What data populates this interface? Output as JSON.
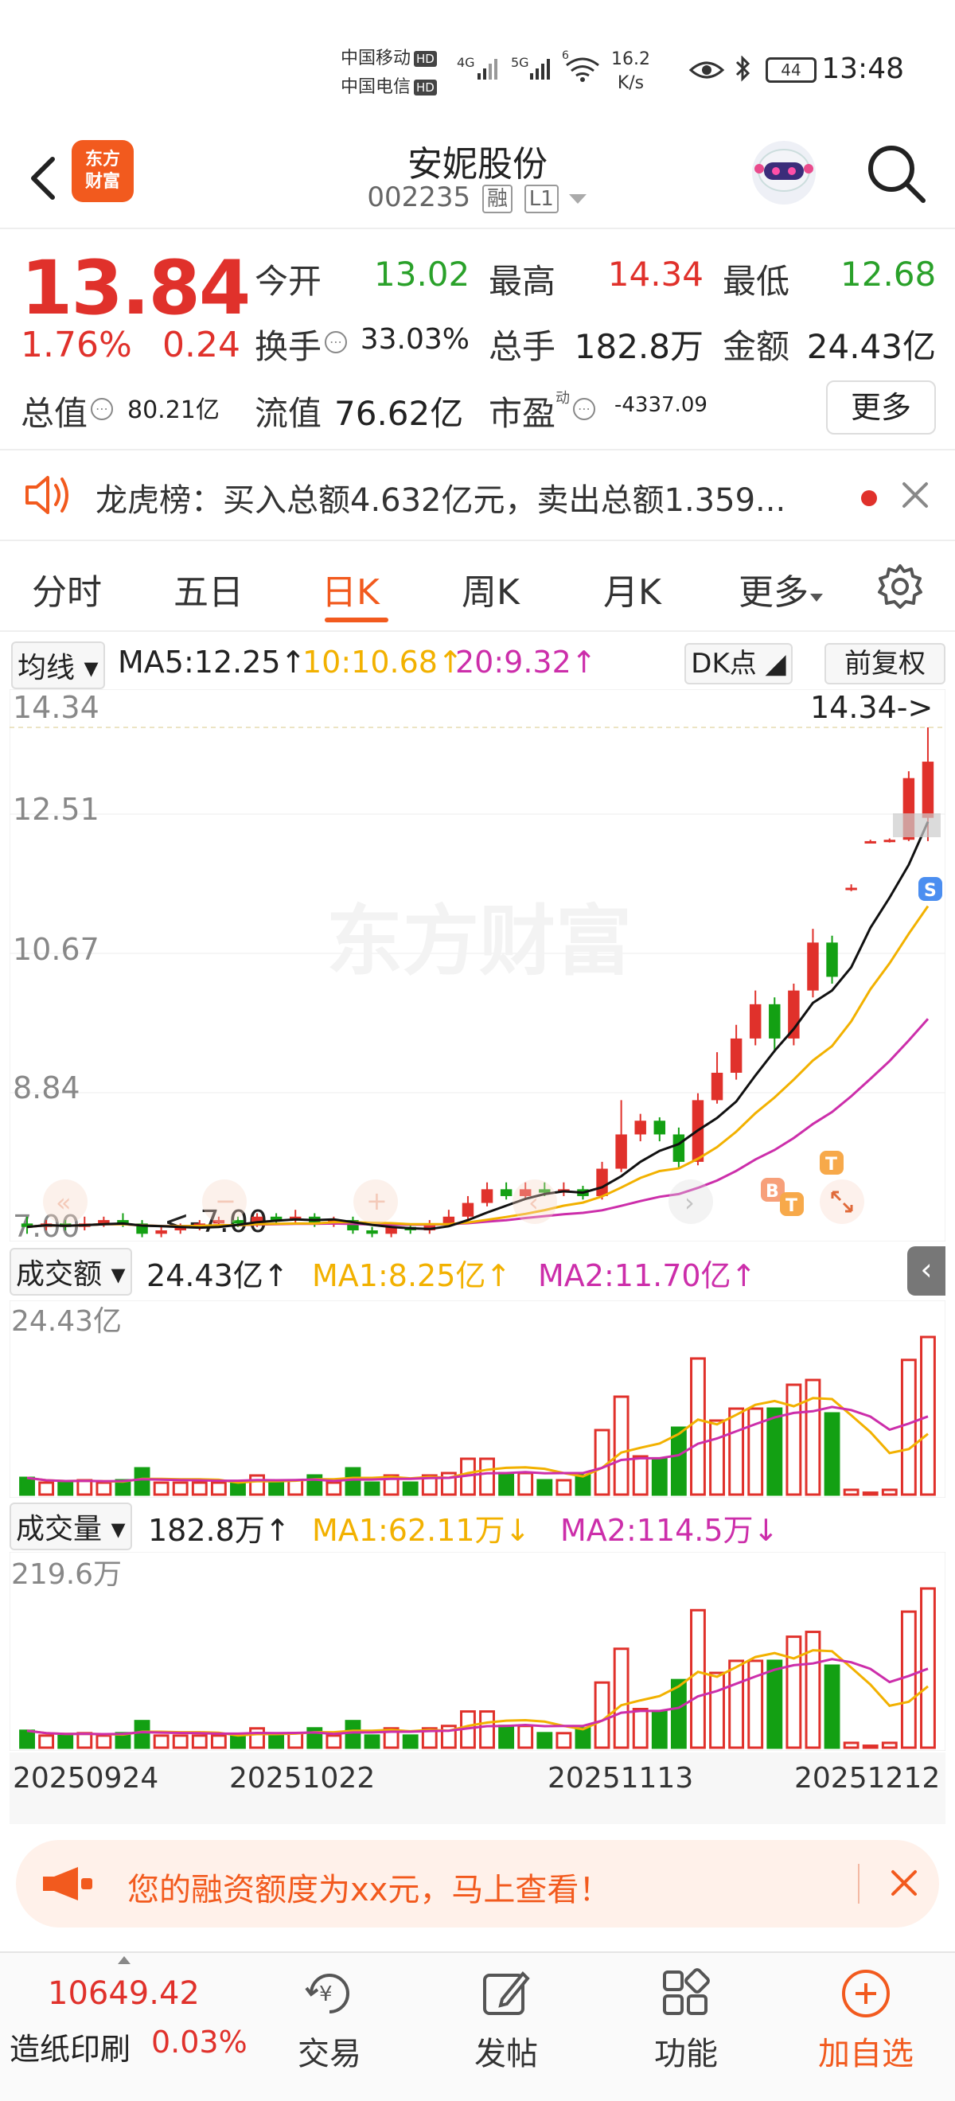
{
  "status_bar": {
    "carrier1": "中国移动",
    "carrier2": "中国电信",
    "hd": "HD",
    "net1": "4G",
    "net2": "5G",
    "wifi_tag": "6",
    "speed_value": "16.2",
    "speed_unit": "K/s",
    "battery": "44",
    "time": "13:48"
  },
  "header": {
    "logo_line1": "东方",
    "logo_line2": "财富",
    "stock_name": "安妮股份",
    "stock_code": "002235",
    "tag_margin": "融",
    "tag_level": "L1"
  },
  "quote": {
    "price": "13.84",
    "pct_change": "1.76%",
    "abs_change": "0.24",
    "open_label": "今开",
    "open_value": "13.02",
    "high_label": "最高",
    "high_value": "14.34",
    "low_label": "最低",
    "low_value": "12.68",
    "turnover_label": "换手",
    "turnover_value": "33.03%",
    "volume_label": "总手",
    "volume_value": "182.8万",
    "amount_label": "金额",
    "amount_value": "24.43亿",
    "mktcap_label": "总值",
    "mktcap_value": "80.21亿",
    "float_label": "流值",
    "float_value": "76.62亿",
    "pe_label": "市盈",
    "pe_sup": "动",
    "pe_value": "-4337.09",
    "more_button": "更多"
  },
  "notice": {
    "text": "龙虎榜：买入总额4.632亿元，卖出总额1.359..."
  },
  "tabs": [
    "分时",
    "五日",
    "日K",
    "周K",
    "月K",
    "更多"
  ],
  "active_tab": "日K",
  "ma_bar": {
    "dropdown": "均线",
    "ma5": "MA5:12.25↑",
    "ma10": "10:10.68↑",
    "ma20": "20:9.32↑",
    "dk_button": "DK点",
    "fq_button": "前复权"
  },
  "kline": {
    "y_labels": [
      "14.34",
      "12.51",
      "10.67",
      "8.84",
      "7.00"
    ],
    "max_marker": "14.34->",
    "min_marker": "<-7.00",
    "watermark": "东方财富",
    "badge_s": "S",
    "badge_b": "B",
    "badge_t": "T"
  },
  "amount_panel": {
    "dropdown": "成交额",
    "value": "24.43亿↑",
    "ma1": "MA1:8.25亿↑",
    "ma2": "MA2:11.70亿↑",
    "y_top": "24.43亿"
  },
  "volume_panel": {
    "dropdown": "成交量",
    "value": "182.8万↑",
    "ma1": "MA1:62.11万↓",
    "ma2": "MA2:114.5万↓",
    "y_top": "219.6万"
  },
  "dates": [
    "20250924",
    "20251022",
    "20251113",
    "20251212"
  ],
  "promo": {
    "text": "您的融资额度为xx元，马上查看！"
  },
  "bottom_bar": {
    "index_value": "10649.42",
    "index_name": "造纸印刷",
    "index_pct": "0.03%",
    "nav": [
      "交易",
      "发帖",
      "功能",
      "加自选"
    ]
  },
  "colors": {
    "up": "#e0312b",
    "down": "#13a013",
    "ma5": "#111111",
    "ma10": "#f2b100",
    "ma20": "#cc2eaa",
    "brand": "#f25a1e"
  },
  "chart_data": {
    "type": "candlestick",
    "title": "",
    "ylim": [
      7.0,
      14.34
    ],
    "candles": [
      {
        "o": 7.1,
        "c": 7.05,
        "h": 7.2,
        "l": 6.95
      },
      {
        "o": 7.05,
        "c": 7.1,
        "h": 7.15,
        "l": 7.0
      },
      {
        "o": 7.1,
        "c": 7.05,
        "h": 7.15,
        "l": 7.0
      },
      {
        "o": 7.05,
        "c": 7.1,
        "h": 7.2,
        "l": 7.0
      },
      {
        "o": 7.1,
        "c": 7.15,
        "h": 7.2,
        "l": 7.05
      },
      {
        "o": 7.15,
        "c": 7.1,
        "h": 7.25,
        "l": 7.05
      },
      {
        "o": 7.1,
        "c": 6.95,
        "h": 7.15,
        "l": 6.9
      },
      {
        "o": 6.95,
        "c": 7.0,
        "h": 7.05,
        "l": 6.9
      },
      {
        "o": 7.0,
        "c": 7.05,
        "h": 7.1,
        "l": 6.95
      },
      {
        "o": 7.05,
        "c": 7.1,
        "h": 7.15,
        "l": 7.0
      },
      {
        "o": 7.1,
        "c": 7.15,
        "h": 7.2,
        "l": 7.05
      },
      {
        "o": 7.15,
        "c": 7.1,
        "h": 7.2,
        "l": 7.05
      },
      {
        "o": 7.1,
        "c": 7.2,
        "h": 7.25,
        "l": 7.05
      },
      {
        "o": 7.2,
        "c": 7.15,
        "h": 7.25,
        "l": 7.1
      },
      {
        "o": 7.15,
        "c": 7.2,
        "h": 7.3,
        "l": 7.1
      },
      {
        "o": 7.2,
        "c": 7.1,
        "h": 7.25,
        "l": 7.05
      },
      {
        "o": 7.1,
        "c": 7.15,
        "h": 7.2,
        "l": 7.05
      },
      {
        "o": 7.15,
        "c": 7.0,
        "h": 7.2,
        "l": 6.95
      },
      {
        "o": 7.0,
        "c": 6.95,
        "h": 7.05,
        "l": 6.9
      },
      {
        "o": 6.95,
        "c": 7.05,
        "h": 7.1,
        "l": 6.9
      },
      {
        "o": 7.05,
        "c": 7.0,
        "h": 7.1,
        "l": 6.95
      },
      {
        "o": 7.0,
        "c": 7.1,
        "h": 7.15,
        "l": 6.95
      },
      {
        "o": 7.1,
        "c": 7.2,
        "h": 7.3,
        "l": 7.05
      },
      {
        "o": 7.2,
        "c": 7.4,
        "h": 7.5,
        "l": 7.15
      },
      {
        "o": 7.4,
        "c": 7.6,
        "h": 7.7,
        "l": 7.35
      },
      {
        "o": 7.6,
        "c": 7.5,
        "h": 7.7,
        "l": 7.45
      },
      {
        "o": 7.5,
        "c": 7.6,
        "h": 7.7,
        "l": 7.45
      },
      {
        "o": 7.6,
        "c": 7.55,
        "h": 7.7,
        "l": 7.5
      },
      {
        "o": 7.55,
        "c": 7.6,
        "h": 7.7,
        "l": 7.5
      },
      {
        "o": 7.6,
        "c": 7.5,
        "h": 7.65,
        "l": 7.45
      },
      {
        "o": 7.5,
        "c": 7.9,
        "h": 8.0,
        "l": 7.45
      },
      {
        "o": 7.9,
        "c": 8.4,
        "h": 8.9,
        "l": 7.85
      },
      {
        "o": 8.4,
        "c": 8.6,
        "h": 8.7,
        "l": 8.3
      },
      {
        "o": 8.6,
        "c": 8.4,
        "h": 8.65,
        "l": 8.3
      },
      {
        "o": 8.4,
        "c": 8.0,
        "h": 8.5,
        "l": 7.9
      },
      {
        "o": 8.0,
        "c": 8.9,
        "h": 9.0,
        "l": 7.95
      },
      {
        "o": 8.9,
        "c": 9.3,
        "h": 9.6,
        "l": 8.85
      },
      {
        "o": 9.3,
        "c": 9.8,
        "h": 10.0,
        "l": 9.2
      },
      {
        "o": 9.8,
        "c": 10.3,
        "h": 10.5,
        "l": 9.7
      },
      {
        "o": 10.3,
        "c": 9.8,
        "h": 10.4,
        "l": 9.6
      },
      {
        "o": 9.8,
        "c": 10.5,
        "h": 10.6,
        "l": 9.7
      },
      {
        "o": 10.5,
        "c": 11.2,
        "h": 11.4,
        "l": 10.4
      },
      {
        "o": 11.2,
        "c": 10.7,
        "h": 11.3,
        "l": 10.6
      },
      {
        "o": 12.0,
        "c": 12.0,
        "h": 12.05,
        "l": 11.95
      },
      {
        "o": 12.68,
        "c": 12.68,
        "h": 12.7,
        "l": 12.66
      },
      {
        "o": 12.68,
        "c": 12.7,
        "h": 12.72,
        "l": 12.66
      },
      {
        "o": 12.7,
        "c": 13.6,
        "h": 13.7,
        "l": 12.68
      },
      {
        "o": 13.02,
        "c": 13.84,
        "h": 14.34,
        "l": 12.68
      }
    ],
    "ma": [
      {
        "name": "MA5",
        "value": "12.25"
      },
      {
        "name": "10",
        "value": "10.68"
      },
      {
        "name": "20",
        "value": "9.32"
      }
    ],
    "amount_panel": {
      "ylim": [
        0,
        24.43
      ],
      "unit": "亿"
    },
    "volume_panel": {
      "ylim": [
        0,
        219.6
      ],
      "unit": "万"
    }
  }
}
